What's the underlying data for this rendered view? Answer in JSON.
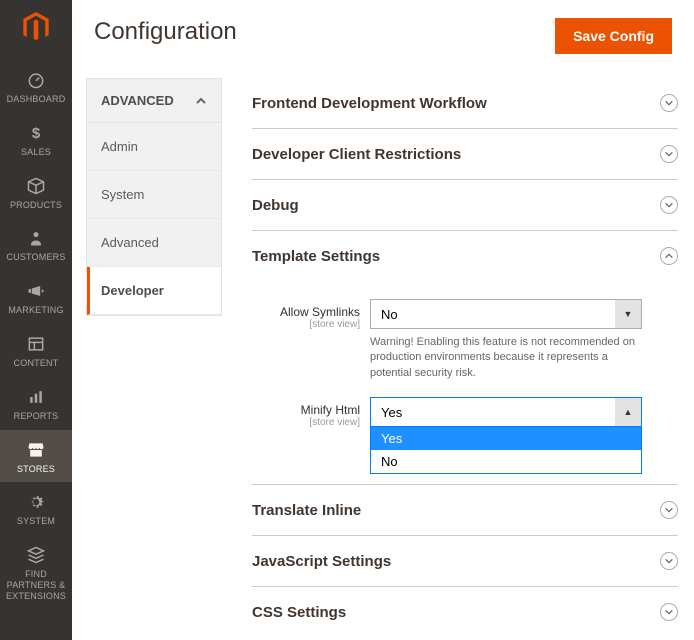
{
  "header": {
    "title": "Configuration",
    "save_label": "Save Config"
  },
  "nav": {
    "items": [
      {
        "label": "DASHBOARD"
      },
      {
        "label": "SALES"
      },
      {
        "label": "PRODUCTS"
      },
      {
        "label": "CUSTOMERS"
      },
      {
        "label": "MARKETING"
      },
      {
        "label": "CONTENT"
      },
      {
        "label": "REPORTS"
      },
      {
        "label": "STORES"
      },
      {
        "label": "SYSTEM"
      },
      {
        "label": "FIND PARTNERS & EXTENSIONS"
      }
    ]
  },
  "sidebar": {
    "group_label": "ADVANCED",
    "items": [
      {
        "label": "Admin"
      },
      {
        "label": "System"
      },
      {
        "label": "Advanced"
      },
      {
        "label": "Developer"
      }
    ]
  },
  "sections": {
    "frontend": "Frontend Development Workflow",
    "restrictions": "Developer Client Restrictions",
    "debug": "Debug",
    "template": "Template Settings",
    "translate": "Translate Inline",
    "js": "JavaScript Settings",
    "css": "CSS Settings"
  },
  "template_settings": {
    "allow_symlinks": {
      "label": "Allow Symlinks",
      "scope": "[store view]",
      "value": "No",
      "warning": "Warning! Enabling this feature is not recommended on production environments because it represents a potential security risk."
    },
    "minify_html": {
      "label": "Minify Html",
      "scope": "[store view]",
      "value": "Yes",
      "options": [
        "Yes",
        "No"
      ]
    }
  }
}
